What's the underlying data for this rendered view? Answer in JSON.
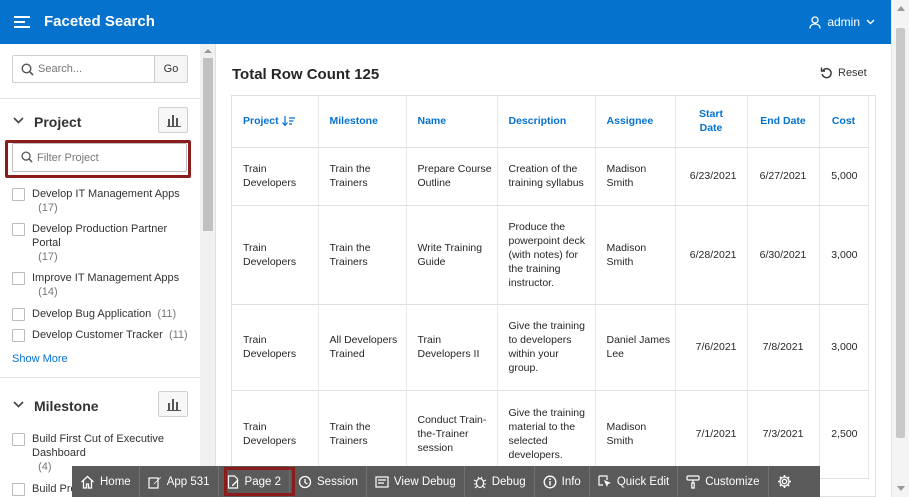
{
  "header": {
    "title": "Faceted Search",
    "user": "admin"
  },
  "sidebar": {
    "search": {
      "placeholder": "Search...",
      "go_label": "Go"
    },
    "project": {
      "title": "Project",
      "filter_placeholder": "Filter Project",
      "options": [
        {
          "label": "Develop IT Management Apps",
          "count": "(17)"
        },
        {
          "label": "Develop Production Partner Portal",
          "count": "(17)"
        },
        {
          "label": "Improve IT Management Apps",
          "count": "(14)"
        },
        {
          "label": "Develop Bug Application",
          "count": "(11)"
        },
        {
          "label": "Develop Customer Tracker",
          "count": "(11)"
        }
      ],
      "show_more": "Show More"
    },
    "milestone": {
      "title": "Milestone",
      "options": [
        {
          "label": "Build First Cut of Executive Dashboard",
          "count": "(4)"
        },
        {
          "label": "Build Pro",
          "count": ""
        }
      ]
    }
  },
  "main": {
    "title": "Total Row Count 125",
    "reset_label": "Reset",
    "columns": [
      "Project",
      "Milestone",
      "Name",
      "Description",
      "Assignee",
      "Start Date",
      "End Date",
      "Cost"
    ],
    "rows": [
      {
        "project": "Train Developers",
        "milestone": "Train the Trainers",
        "name": "Prepare Course Outline",
        "description": "Creation of the training syllabus",
        "assignee": "Madison Smith",
        "start": "6/23/2021",
        "end": "6/27/2021",
        "cost": "5,000"
      },
      {
        "project": "Train Developers",
        "milestone": "Train the Trainers",
        "name": "Write Training Guide",
        "description": "Produce the powerpoint deck (with notes) for the training instructor.",
        "assignee": "Madison Smith",
        "start": "6/28/2021",
        "end": "6/30/2021",
        "cost": "3,000"
      },
      {
        "project": "Train Developers",
        "milestone": "All Developers Trained",
        "name": "Train Developers II",
        "description": "Give the training to developers within your group.",
        "assignee": "Daniel James Lee",
        "start": "7/6/2021",
        "end": "7/8/2021",
        "cost": "3,000"
      },
      {
        "project": "Train Developers",
        "milestone": "Train the Trainers",
        "name": "Conduct Train-the-Trainer session",
        "description": "Give the training material to the selected developers.",
        "assignee": "Madison Smith",
        "start": "7/1/2021",
        "end": "7/3/2021",
        "cost": "2,500"
      }
    ]
  },
  "devbar": {
    "items": [
      {
        "label": "Home",
        "icon": "home-icon"
      },
      {
        "label": "App 531",
        "icon": "edit-icon"
      },
      {
        "label": "Page 2",
        "icon": "page-edit-icon"
      },
      {
        "label": "Session",
        "icon": "session-icon"
      },
      {
        "label": "View Debug",
        "icon": "view-debug-icon"
      },
      {
        "label": "Debug",
        "icon": "bug-icon"
      },
      {
        "label": "Info",
        "icon": "info-icon"
      },
      {
        "label": "Quick Edit",
        "icon": "quick-edit-icon"
      },
      {
        "label": "Customize",
        "icon": "paint-icon"
      },
      {
        "label": "",
        "icon": "gear-icon"
      }
    ]
  },
  "colors": {
    "accent": "#0572ce",
    "highlight": "#8a1c1c",
    "devbar": "#5a5a5a"
  }
}
